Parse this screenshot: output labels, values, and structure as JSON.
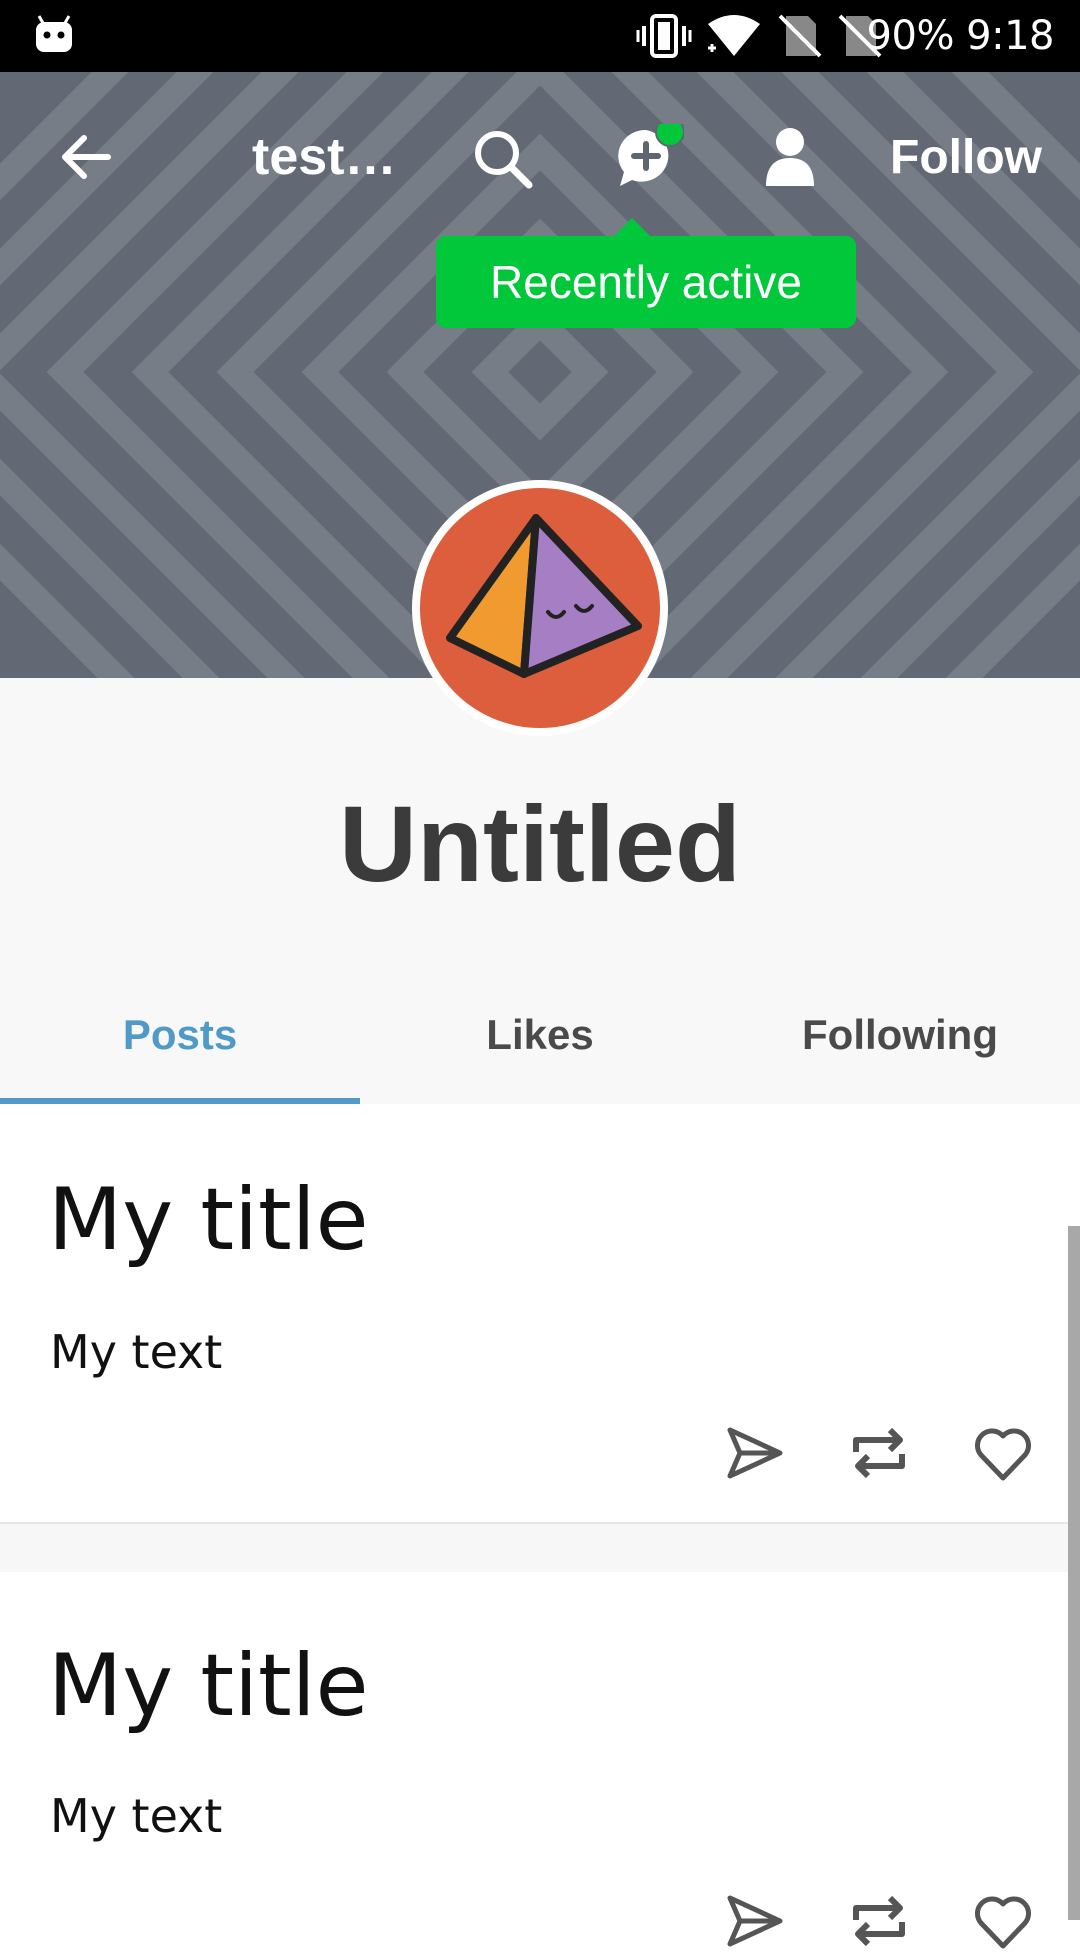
{
  "status_bar": {
    "battery": "90%",
    "time": "9:18",
    "icons": [
      "android-icon",
      "vibrate-icon",
      "wifi-icon",
      "no-sim-icon",
      "no-sim-icon"
    ]
  },
  "header": {
    "title": "test…",
    "follow_label": "Follow",
    "tooltip": "Recently active",
    "icons": [
      "back-arrow-icon",
      "search-icon",
      "message-plus-icon",
      "person-icon"
    ],
    "colors": {
      "online_dot": "#00c83a",
      "tooltip_bg": "#00c83a",
      "banner": "#6b7280"
    }
  },
  "profile": {
    "name": "Untitled",
    "avatar": "pyramid-avatar",
    "colors": {
      "avatar_bg": "#dc5e3c"
    }
  },
  "tabs": [
    {
      "label": "Posts",
      "active": true
    },
    {
      "label": "Likes",
      "active": false
    },
    {
      "label": "Following",
      "active": false
    }
  ],
  "accent": "#4f9ac6",
  "posts": [
    {
      "title": "My title",
      "text": "My text",
      "actions": [
        "share-icon",
        "reblog-icon",
        "heart-icon"
      ]
    },
    {
      "title": "My title",
      "text": "My text",
      "actions": [
        "share-icon",
        "reblog-icon",
        "heart-icon"
      ]
    }
  ]
}
